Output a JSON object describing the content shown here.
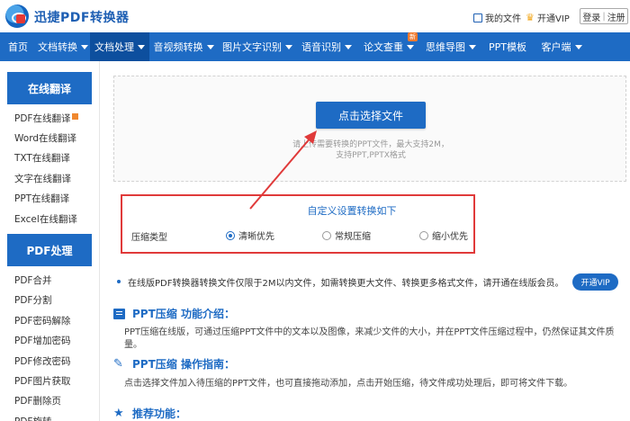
{
  "header": {
    "app_title": "迅捷PDF转换器",
    "my_files": "我的文件",
    "open_vip": "开通VIP",
    "login": "登录",
    "separator": "|",
    "register": "注册"
  },
  "nav": {
    "items": [
      {
        "label": "首页",
        "caret": false
      },
      {
        "label": "文档转换",
        "caret": true
      },
      {
        "label": "文档处理",
        "caret": true,
        "active": true
      },
      {
        "label": "音视频转换",
        "caret": true
      },
      {
        "label": "图片文字识别",
        "caret": true
      },
      {
        "label": "语音识别",
        "caret": true
      },
      {
        "label": "论文查重",
        "caret": true,
        "badge": "新"
      },
      {
        "label": "思维导图",
        "caret": true
      },
      {
        "label": "PPT模板",
        "caret": false
      },
      {
        "label": "客户端",
        "caret": true
      }
    ]
  },
  "sidebar": {
    "translate_title": "在线翻译",
    "translate_items": [
      "PDF在线翻译",
      "Word在线翻译",
      "TXT在线翻译",
      "文字在线翻译",
      "PPT在线翻译",
      "Excel在线翻译"
    ],
    "pdf_title": "PDF处理",
    "pdf_items": [
      "PDF合并",
      "PDF分割",
      "PDF密码解除",
      "PDF增加密码",
      "PDF修改密码",
      "PDF图片获取",
      "PDF删除页",
      "PDF旋转"
    ]
  },
  "upload": {
    "button": "点击选择文件",
    "hint_line1": "请上传需要转换的PPT文件，最大支持2M，",
    "hint_line2": "支持PPT,PPTX格式"
  },
  "options": {
    "title": "自定义设置转换如下",
    "row_label": "压缩类型",
    "choices": [
      "清晰优先",
      "常规压缩",
      "缩小优先"
    ],
    "selected": 0
  },
  "notice": {
    "text": "在线版PDF转换器转换文件仅限于2M以内文件，如需转换更大文件、转换更多格式文件，请开通在线版会员。",
    "vip_button": "开通VIP"
  },
  "intro": {
    "title": "PPT压缩 功能介绍：",
    "text": "PPT压缩在线版，可通过压缩PPT文件中的文本以及图像，来减少文件的大小，并在PPT文件压缩过程中，仍然保证其文件质量。"
  },
  "guide": {
    "title": "PPT压缩 操作指南：",
    "text": "点击选择文件加入待压缩的PPT文件，也可直接拖动添加，点击开始压缩，待文件成功处理后，即可将文件下载。"
  },
  "recommend": {
    "title": "推荐功能："
  },
  "colors": {
    "brand_blue": "#1e6bc4",
    "highlight_red": "#e03a3a",
    "nav_active": "#0d4f9e"
  }
}
